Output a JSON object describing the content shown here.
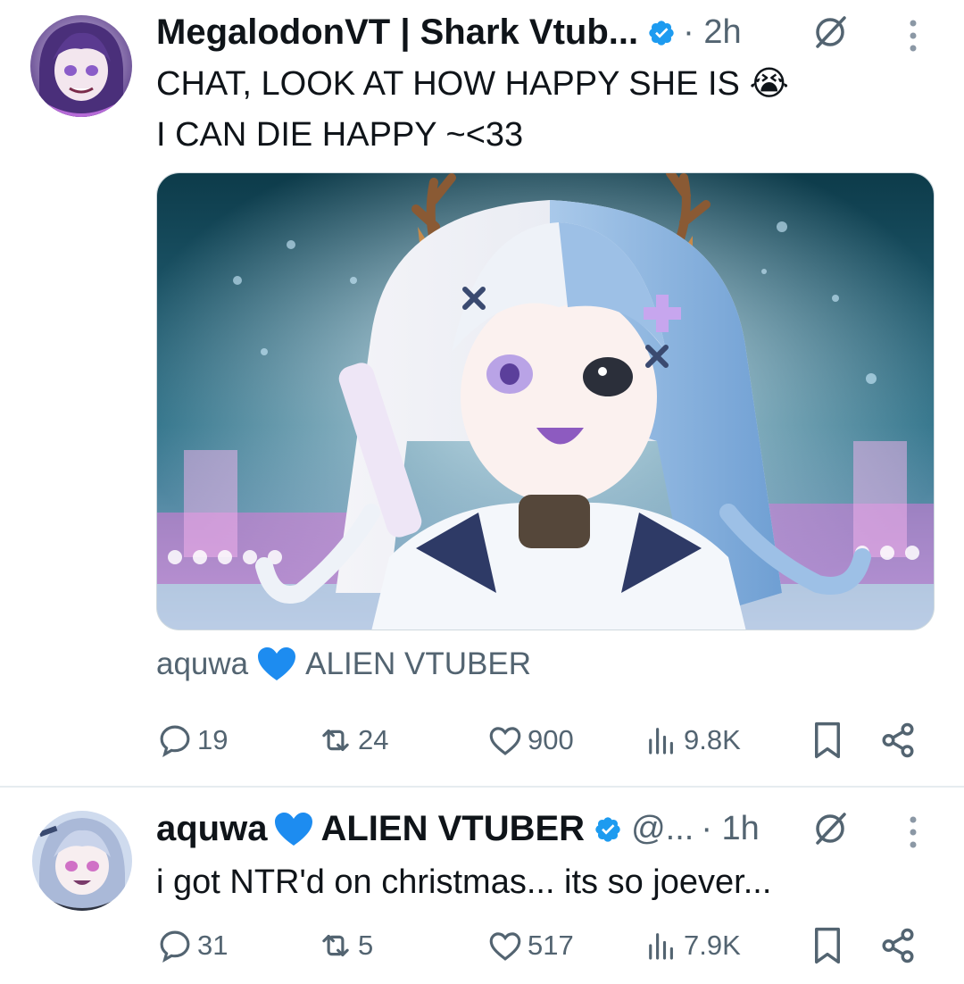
{
  "tweets": [
    {
      "author_name": "MegalodonVT | Shark Vtub...",
      "time": "· 2h",
      "text_lines": [
        "CHAT, LOOK AT HOW HAPPY SHE IS 😭",
        "I CAN DIE HAPPY ~<33"
      ],
      "community_left": "aquwa",
      "community_right": "ALIEN VTUBER",
      "stats": {
        "replies": "19",
        "reposts": "24",
        "likes": "900",
        "views": "9.8K"
      }
    },
    {
      "author_name_left": "aquwa",
      "author_name_right": "ALIEN VTUBER",
      "handle": "@...",
      "time": "· 1h",
      "text_lines": [
        "i got NTR'd on christmas... its so joever..."
      ],
      "stats": {
        "replies": "31",
        "reposts": "5",
        "likes": "517",
        "views": "7.9K"
      }
    }
  ],
  "colors": {
    "verified": "#1d9bf0",
    "heart": "#1d8cf0",
    "secondary_text": "#536471",
    "divider": "#e6ecf0"
  },
  "icons": [
    "verified-badge-icon",
    "grok-icon",
    "more-icon",
    "reply-icon",
    "repost-icon",
    "like-icon",
    "views-icon",
    "bookmark-icon",
    "share-icon",
    "blue-heart-icon"
  ]
}
